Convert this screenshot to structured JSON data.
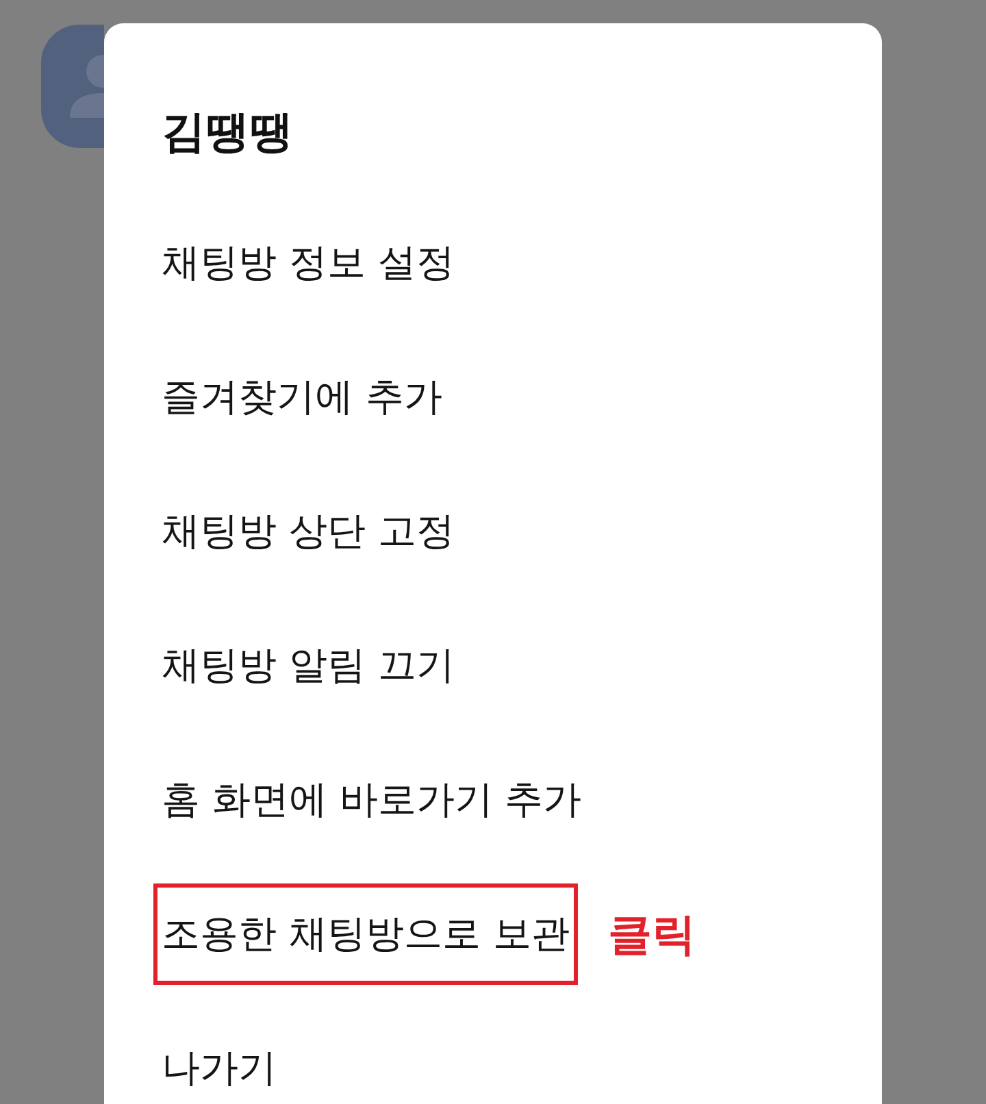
{
  "dialog": {
    "title": "김땡땡",
    "items": [
      {
        "label": "채팅방 정보 설정",
        "highlighted": false
      },
      {
        "label": "즐겨찾기에 추가",
        "highlighted": false
      },
      {
        "label": "채팅방 상단 고정",
        "highlighted": false
      },
      {
        "label": "채팅방 알림 끄기",
        "highlighted": false
      },
      {
        "label": "홈 화면에 바로가기 추가",
        "highlighted": false
      },
      {
        "label": "조용한 채팅방으로 보관",
        "highlighted": true,
        "annotation": "클릭"
      },
      {
        "label": "나가기",
        "highlighted": false
      }
    ]
  }
}
